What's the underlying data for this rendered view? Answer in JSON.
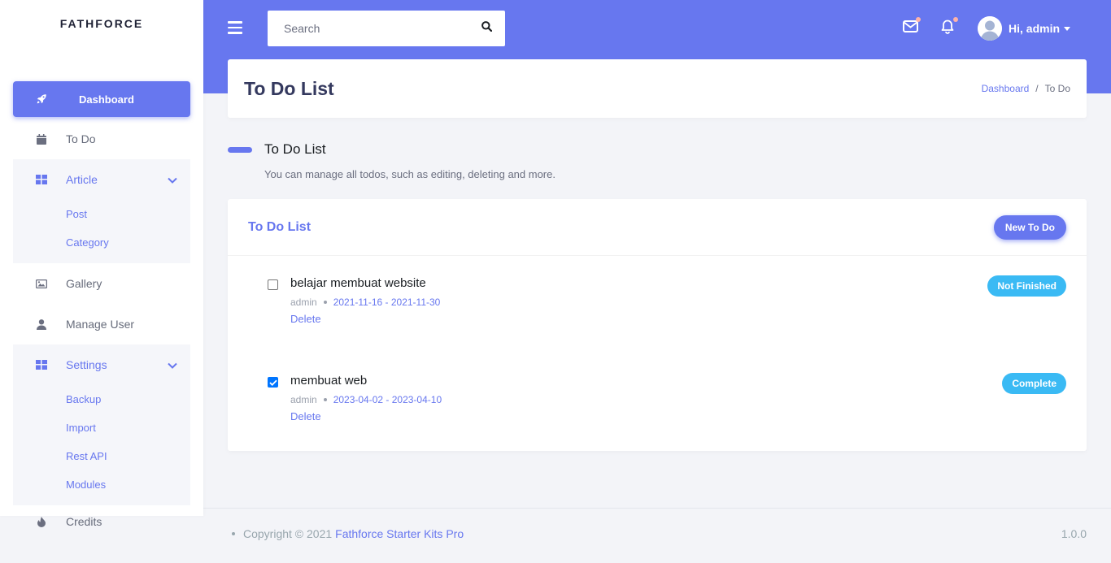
{
  "brand": "FATHFORCE",
  "sidebar": {
    "dashboard": "Dashboard",
    "todo": "To Do",
    "article": {
      "label": "Article",
      "subs": [
        "Post",
        "Category"
      ]
    },
    "gallery": "Gallery",
    "manage_user": "Manage User",
    "settings": {
      "label": "Settings",
      "subs": [
        "Backup",
        "Import",
        "Rest API",
        "Modules"
      ]
    },
    "credits": "Credits"
  },
  "topbar": {
    "search_placeholder": "Search",
    "user": "Hi, admin"
  },
  "header": {
    "title": "To Do List",
    "breadcrumb": [
      "Dashboard",
      "/",
      "To Do"
    ]
  },
  "section": {
    "title": "To Do List",
    "lead": "You can manage all todos, such as editing, deleting and more."
  },
  "card": {
    "title": "To Do List",
    "new_button": "New To Do",
    "todos": [
      {
        "title": "belajar membuat website",
        "author": "admin",
        "dates": "2021-11-16 - 2021-11-30",
        "delete": "Delete",
        "status": "Not Finished",
        "checked": false
      },
      {
        "title": "membuat web",
        "author": "admin",
        "dates": "2023-04-02 - 2023-04-10",
        "delete": "Delete",
        "status": "Complete",
        "checked": true
      }
    ]
  },
  "footer": {
    "copyright": "Copyright © 2021",
    "link": "Fathforce Starter Kits Pro",
    "version": "1.0.0"
  },
  "colors": {
    "primary": "#6777ef",
    "info": "#3abaf4"
  }
}
